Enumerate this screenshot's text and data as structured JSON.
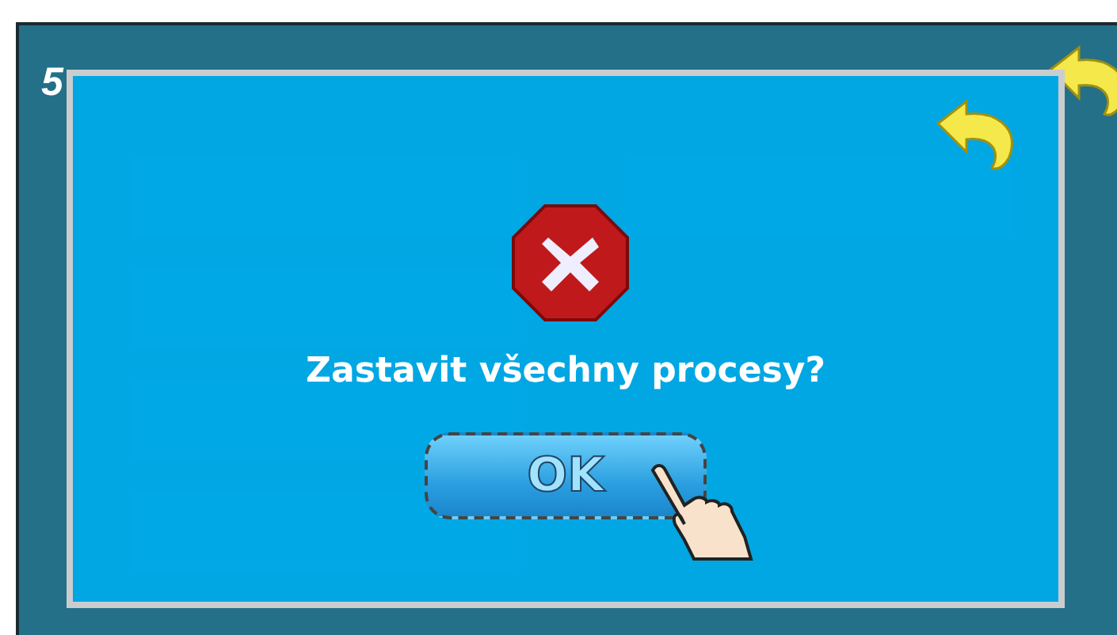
{
  "screen": {
    "title": "5"
  },
  "dialog": {
    "message": "Zastavit všechny procesy?",
    "button": "OK"
  }
}
